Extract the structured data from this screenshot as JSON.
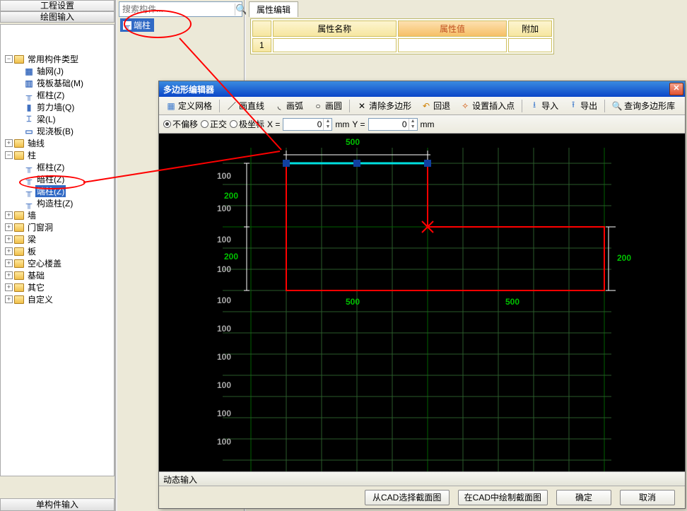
{
  "left": {
    "header1": "工程设置",
    "header2": "绘图输入",
    "bottom": "单构件输入",
    "tree": {
      "root": "常用构件类型",
      "items": [
        "轴网(J)",
        "筏板基础(M)",
        "框柱(Z)",
        "剪力墙(Q)",
        "梁(L)",
        "现浇板(B)"
      ],
      "axis": "轴线",
      "zhu": "柱",
      "zhu_children": [
        "框柱(Z)",
        "暗柱(Z)",
        "端柱(Z)",
        "构造柱(Z)"
      ],
      "rest": [
        "墙",
        "门窗洞",
        "梁",
        "板",
        "空心楼盖",
        "基础",
        "其它",
        "自定义"
      ]
    }
  },
  "search": {
    "placeholder": "搜索构件...",
    "selected": "端柱"
  },
  "prop": {
    "tab": "属性编辑",
    "h_name": "属性名称",
    "h_val": "属性值",
    "h_add": "附加",
    "row1": "1"
  },
  "dialog": {
    "title": "多边形编辑器",
    "tb": {
      "grid": "定义网格",
      "line": "画直线",
      "arc": "画弧",
      "circle": "画圆",
      "clear": "清除多边形",
      "back": "回退",
      "insert": "设置插入点",
      "import": "导入",
      "export": "导出",
      "query": "查询多边形库"
    },
    "tb2": {
      "r1": "不偏移",
      "r2": "正交",
      "r3": "极坐标",
      "x": "X =",
      "y": "Y =",
      "xval": "0",
      "yval": "0",
      "unit": "mm"
    },
    "status": "动态输入",
    "btns": {
      "cad_sel": "从CAD选择截面图",
      "cad_draw": "在CAD中绘制截面图",
      "ok": "确定",
      "cancel": "取消"
    },
    "dims": {
      "top500": "500",
      "left200a": "200",
      "left200b": "200",
      "right200": "200",
      "bot500a": "500",
      "bot500b": "500",
      "h100": "100"
    }
  }
}
